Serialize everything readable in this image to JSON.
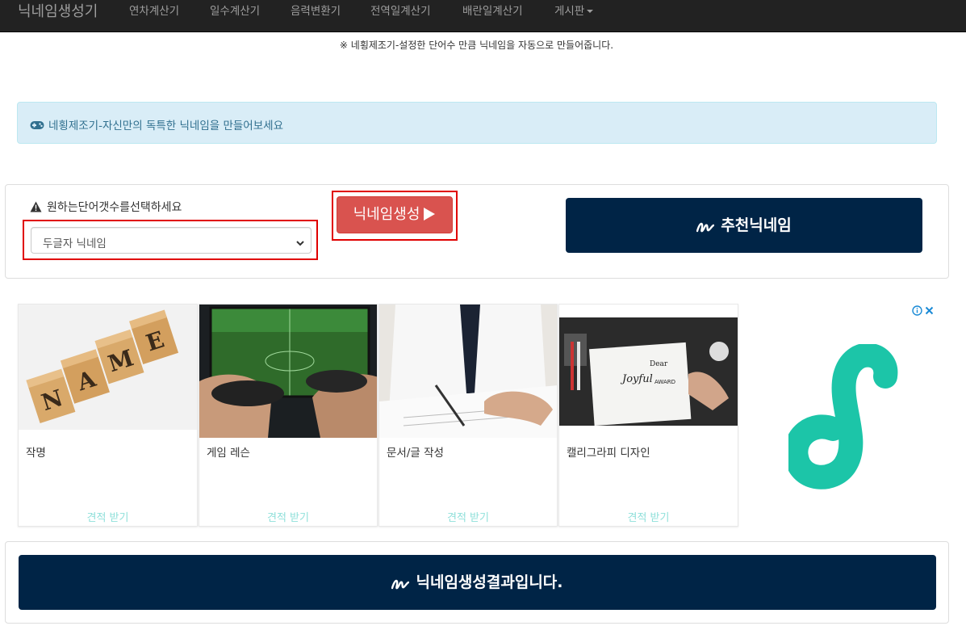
{
  "navbar": {
    "brand": "닉네임생성기",
    "items": [
      {
        "label": "연차계산기"
      },
      {
        "label": "일수계산기"
      },
      {
        "label": "음력변환기"
      },
      {
        "label": "전역일계산기"
      },
      {
        "label": "배란일계산기"
      },
      {
        "label": "게시판"
      }
    ]
  },
  "notice": "※ 네횡제조기-설정한 단어수 만큼 닉네임을 자동으로 만들어줍니다.",
  "alert": {
    "text": "네횡제조기-자신만의 독특한 닉네임을 만들어보세요",
    "icon": "gamepad-icon"
  },
  "form": {
    "prompt": "원하는단어갯수를선택하세요",
    "select_value": "두글자 닉네임",
    "generate_label": "닉네임생성",
    "recommend_label": "추천닉네임"
  },
  "ad": {
    "cards": [
      {
        "title": "작명",
        "cta": "견적 받기"
      },
      {
        "title": "게임 레슨",
        "cta": "견적 받기"
      },
      {
        "title": "문서/글 작성",
        "cta": "견적 받기"
      },
      {
        "title": "캘리그라피 디자인",
        "cta": "견적 받기"
      }
    ],
    "logo_color": "#1cc5a8"
  },
  "result_label": "닉네임생성결과입니다.",
  "colors": {
    "navy": "#002446",
    "danger": "#d9534f",
    "highlight": "#e00000",
    "alert_bg": "#d9edf7"
  }
}
